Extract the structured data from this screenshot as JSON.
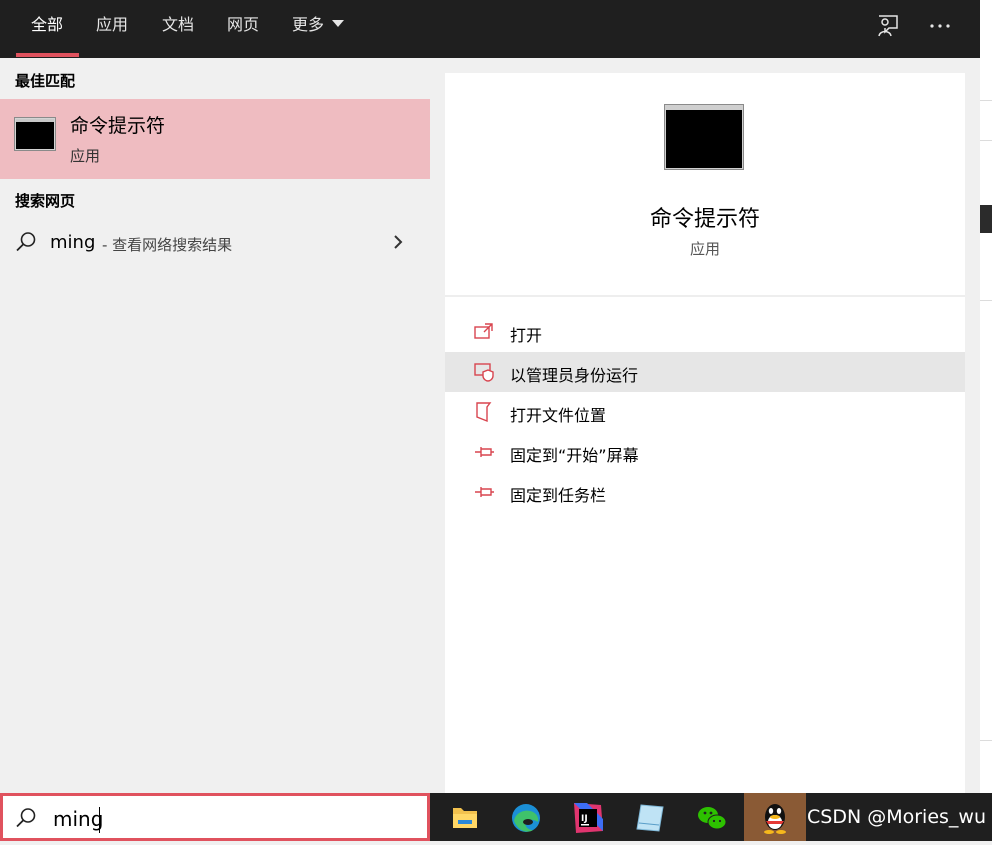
{
  "top_tabs": [
    {
      "label": "全部",
      "active": true
    },
    {
      "label": "应用",
      "active": false
    },
    {
      "label": "文档",
      "active": false
    },
    {
      "label": "网页",
      "active": false
    },
    {
      "label": "更多",
      "active": false
    }
  ],
  "top_right_icons": [
    "feedback-icon",
    "more-options-icon"
  ],
  "colors": {
    "accent": "#e0525e",
    "highlight": "#efbcc1",
    "topbar": "#1f1f1f"
  },
  "left": {
    "best_match_title": "最佳匹配",
    "best_match": {
      "name": "命令提示符",
      "type": "应用"
    },
    "web_title": "搜索网页",
    "web_result": {
      "term": "ming",
      "desc": "- 查看网络搜索结果"
    }
  },
  "right": {
    "app_name": "命令提示符",
    "app_type": "应用",
    "actions": [
      {
        "label": "打开",
        "icon": "open-icon"
      },
      {
        "label": "以管理员身份运行",
        "icon": "run-as-admin-icon"
      },
      {
        "label": "打开文件位置",
        "icon": "file-location-icon"
      },
      {
        "label": "固定到“开始”屏幕",
        "icon": "pin-start-icon"
      },
      {
        "label": "固定到任务栏",
        "icon": "pin-taskbar-icon"
      }
    ]
  },
  "search": {
    "value": "ming"
  },
  "taskbar": {
    "apps": [
      "file-explorer-icon",
      "edge-icon",
      "intellij-icon",
      "notepad-icon",
      "wechat-icon",
      "qq-icon"
    ],
    "watermark": "CSDN @Mories_wu"
  }
}
